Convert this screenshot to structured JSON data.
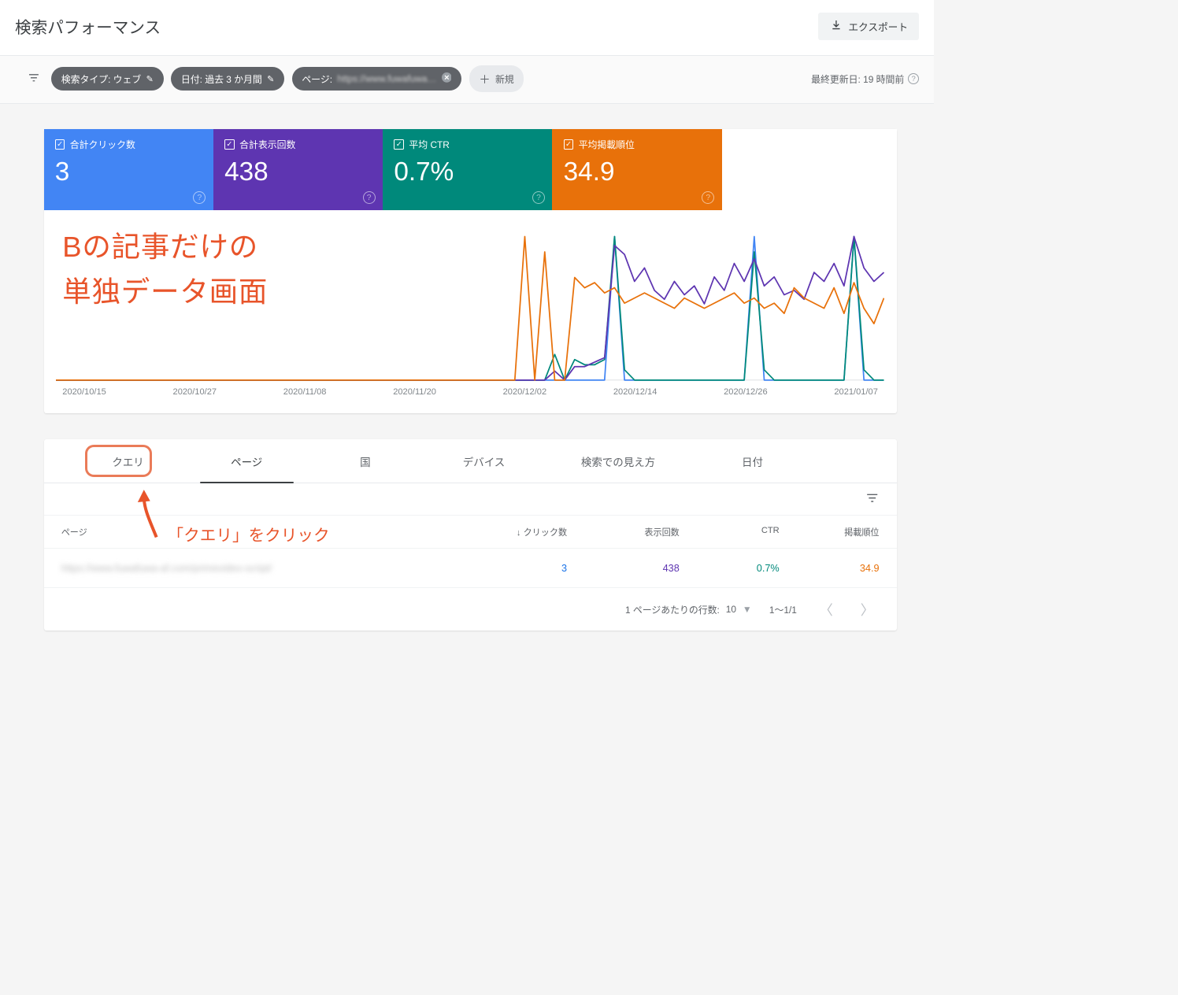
{
  "header": {
    "title": "検索パフォーマンス",
    "export_label": "エクスポート"
  },
  "filters": {
    "search_type": "検索タイプ: ウェブ",
    "date": "日付: 過去 3 か月間",
    "page_prefix": "ページ:",
    "page_url": "https://www.fuwafuwa…",
    "new_label": "新規",
    "last_updated": "最終更新日: 19 時間前"
  },
  "metrics": {
    "clicks": {
      "label": "合計クリック数",
      "value": "3"
    },
    "impressions": {
      "label": "合計表示回数",
      "value": "438"
    },
    "ctr": {
      "label": "平均 CTR",
      "value": "0.7%"
    },
    "position": {
      "label": "平均掲載順位",
      "value": "34.9"
    }
  },
  "annotation": {
    "line1": "Bの記事だけの",
    "line2": "単独データ画面",
    "click_instruction": "「クエリ」をクリック"
  },
  "chart_data": {
    "type": "line",
    "x_labels": [
      "2020/10/15",
      "2020/10/27",
      "2020/11/08",
      "2020/11/20",
      "2020/12/02",
      "2020/12/14",
      "2020/12/26",
      "2021/01/07"
    ],
    "series": [
      {
        "name": "clicks",
        "color": "#4285f4",
        "values": [
          0,
          0,
          0,
          0,
          0,
          0,
          0,
          0,
          0,
          0,
          0,
          0,
          0,
          0,
          0,
          0,
          0,
          0,
          0,
          0,
          0,
          0,
          0,
          0,
          0,
          0,
          0,
          0,
          0,
          0,
          0,
          0,
          0,
          0,
          0,
          0,
          0,
          0,
          0,
          0,
          0,
          0,
          0,
          0,
          0,
          0,
          0,
          0,
          0,
          0,
          0,
          0,
          0,
          0,
          0,
          0,
          1,
          0,
          0,
          0,
          0,
          0,
          0,
          0,
          0,
          0,
          0,
          0,
          0,
          0,
          1,
          0,
          0,
          0,
          0,
          0,
          0,
          0,
          0,
          0,
          1,
          0,
          0,
          0
        ]
      },
      {
        "name": "ctr",
        "color": "#00897b",
        "values": [
          0,
          0,
          0,
          0,
          0,
          0,
          0,
          0,
          0,
          0,
          0,
          0,
          0,
          0,
          0,
          0,
          0,
          0,
          0,
          0,
          0,
          0,
          0,
          0,
          0,
          0,
          0,
          0,
          0,
          0,
          0,
          0,
          0,
          0,
          0,
          0,
          0,
          0,
          0,
          0,
          0,
          0,
          0,
          0,
          0,
          0,
          0,
          0,
          0,
          0,
          5,
          0,
          4,
          3,
          3,
          4,
          28,
          2,
          0,
          0,
          0,
          0,
          0,
          0,
          0,
          0,
          0,
          0,
          0,
          0,
          25,
          2,
          0,
          0,
          0,
          0,
          0,
          0,
          0,
          0,
          28,
          2,
          0,
          0
        ]
      },
      {
        "name": "impressions",
        "color": "#5e35b1",
        "values": [
          0,
          0,
          0,
          0,
          0,
          0,
          0,
          0,
          0,
          0,
          0,
          0,
          0,
          0,
          0,
          0,
          0,
          0,
          0,
          0,
          0,
          0,
          0,
          0,
          0,
          0,
          0,
          0,
          0,
          0,
          0,
          0,
          0,
          0,
          0,
          0,
          0,
          0,
          0,
          0,
          0,
          0,
          0,
          0,
          0,
          0,
          0,
          0,
          0,
          0,
          2,
          0,
          3,
          3,
          4,
          5,
          30,
          28,
          22,
          25,
          20,
          18,
          22,
          19,
          21,
          17,
          23,
          20,
          26,
          22,
          27,
          21,
          23,
          19,
          20,
          18,
          24,
          22,
          26,
          21,
          32,
          25,
          22,
          24
        ]
      },
      {
        "name": "position",
        "color": "#e8710a",
        "values": [
          0,
          0,
          0,
          0,
          0,
          0,
          0,
          0,
          0,
          0,
          0,
          0,
          0,
          0,
          0,
          0,
          0,
          0,
          0,
          0,
          0,
          0,
          0,
          0,
          0,
          0,
          0,
          0,
          0,
          0,
          0,
          0,
          0,
          0,
          0,
          0,
          0,
          0,
          0,
          0,
          0,
          0,
          0,
          0,
          0,
          0,
          0,
          28,
          0,
          25,
          0,
          0,
          20,
          18,
          19,
          17,
          18,
          15,
          16,
          17,
          16,
          15,
          14,
          16,
          15,
          14,
          15,
          16,
          17,
          15,
          16,
          14,
          15,
          13,
          18,
          16,
          15,
          14,
          18,
          13,
          19,
          14,
          11,
          16
        ]
      }
    ]
  },
  "tabs": [
    "クエリ",
    "ページ",
    "国",
    "デバイス",
    "検索での見え方",
    "日付"
  ],
  "table": {
    "headers": {
      "page": "ページ",
      "clicks": "クリック数",
      "impressions": "表示回数",
      "ctr": "CTR",
      "position": "掲載順位"
    },
    "row": {
      "url": "https://www.fuwafuwa-af.com/primevideo-script/",
      "clicks": "3",
      "impressions": "438",
      "ctr": "0.7%",
      "position": "34.9"
    },
    "pagination": {
      "rows_label": "1 ページあたりの行数:",
      "rows_value": "10",
      "range": "1～1/1"
    }
  }
}
